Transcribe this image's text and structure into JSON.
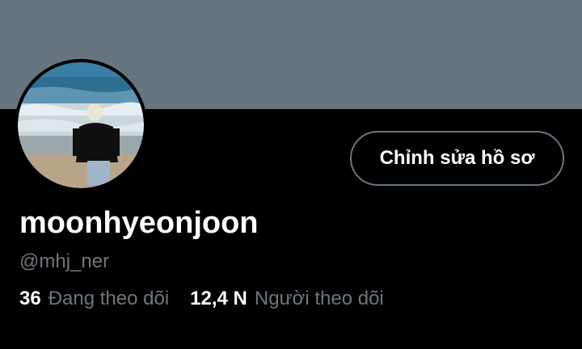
{
  "profile": {
    "display_name": "moonhyeonjoon",
    "handle": "@mhj_ner",
    "avatar_alt": "profile-photo",
    "edit_button_label": "Chỉnh sửa hồ sơ"
  },
  "stats": {
    "following_count": "36",
    "following_label": "Đang theo dõi",
    "followers_count": "12,4 N",
    "followers_label": "Người theo dõi"
  },
  "colors": {
    "banner": "#66757f",
    "background": "#000000",
    "text_primary": "#ffffff",
    "text_secondary": "#6e767d",
    "button_border": "#657786"
  }
}
